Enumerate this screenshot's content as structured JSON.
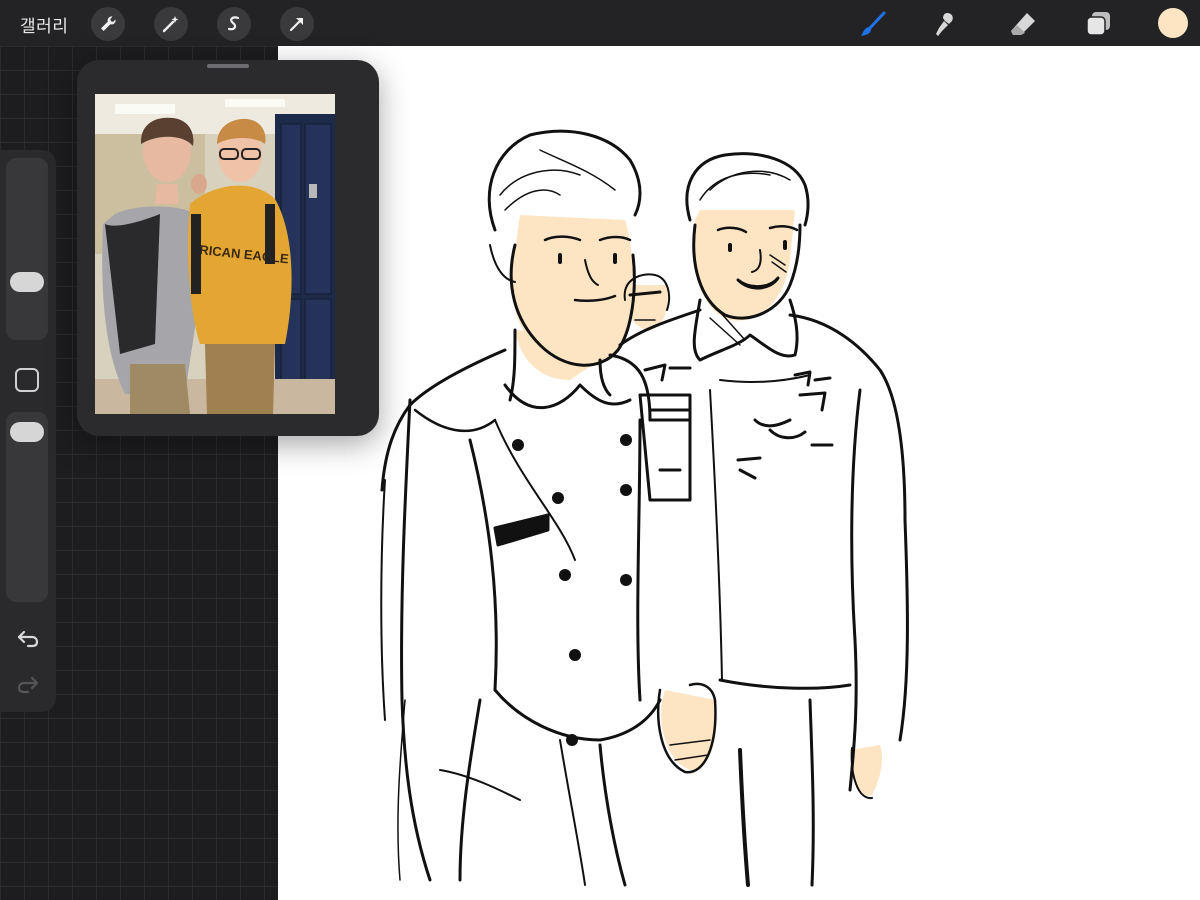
{
  "topbar": {
    "gallery_label": "갤러리",
    "left_tools": [
      "wrench-icon",
      "magic-wand-icon",
      "selection-icon",
      "transform-arrow-icon"
    ],
    "right_tools": [
      "brush-icon",
      "smudge-icon",
      "eraser-icon",
      "layers-icon"
    ],
    "active_tool": "brush-icon",
    "active_color": "#fde5c4",
    "accent_color": "#1e73e8"
  },
  "sidebar": {
    "controls": [
      "brush-size-slider",
      "modify-button",
      "opacity-slider",
      "undo-button",
      "redo-button"
    ]
  },
  "reference": {
    "photo_text": "RICAN EAGLE"
  }
}
